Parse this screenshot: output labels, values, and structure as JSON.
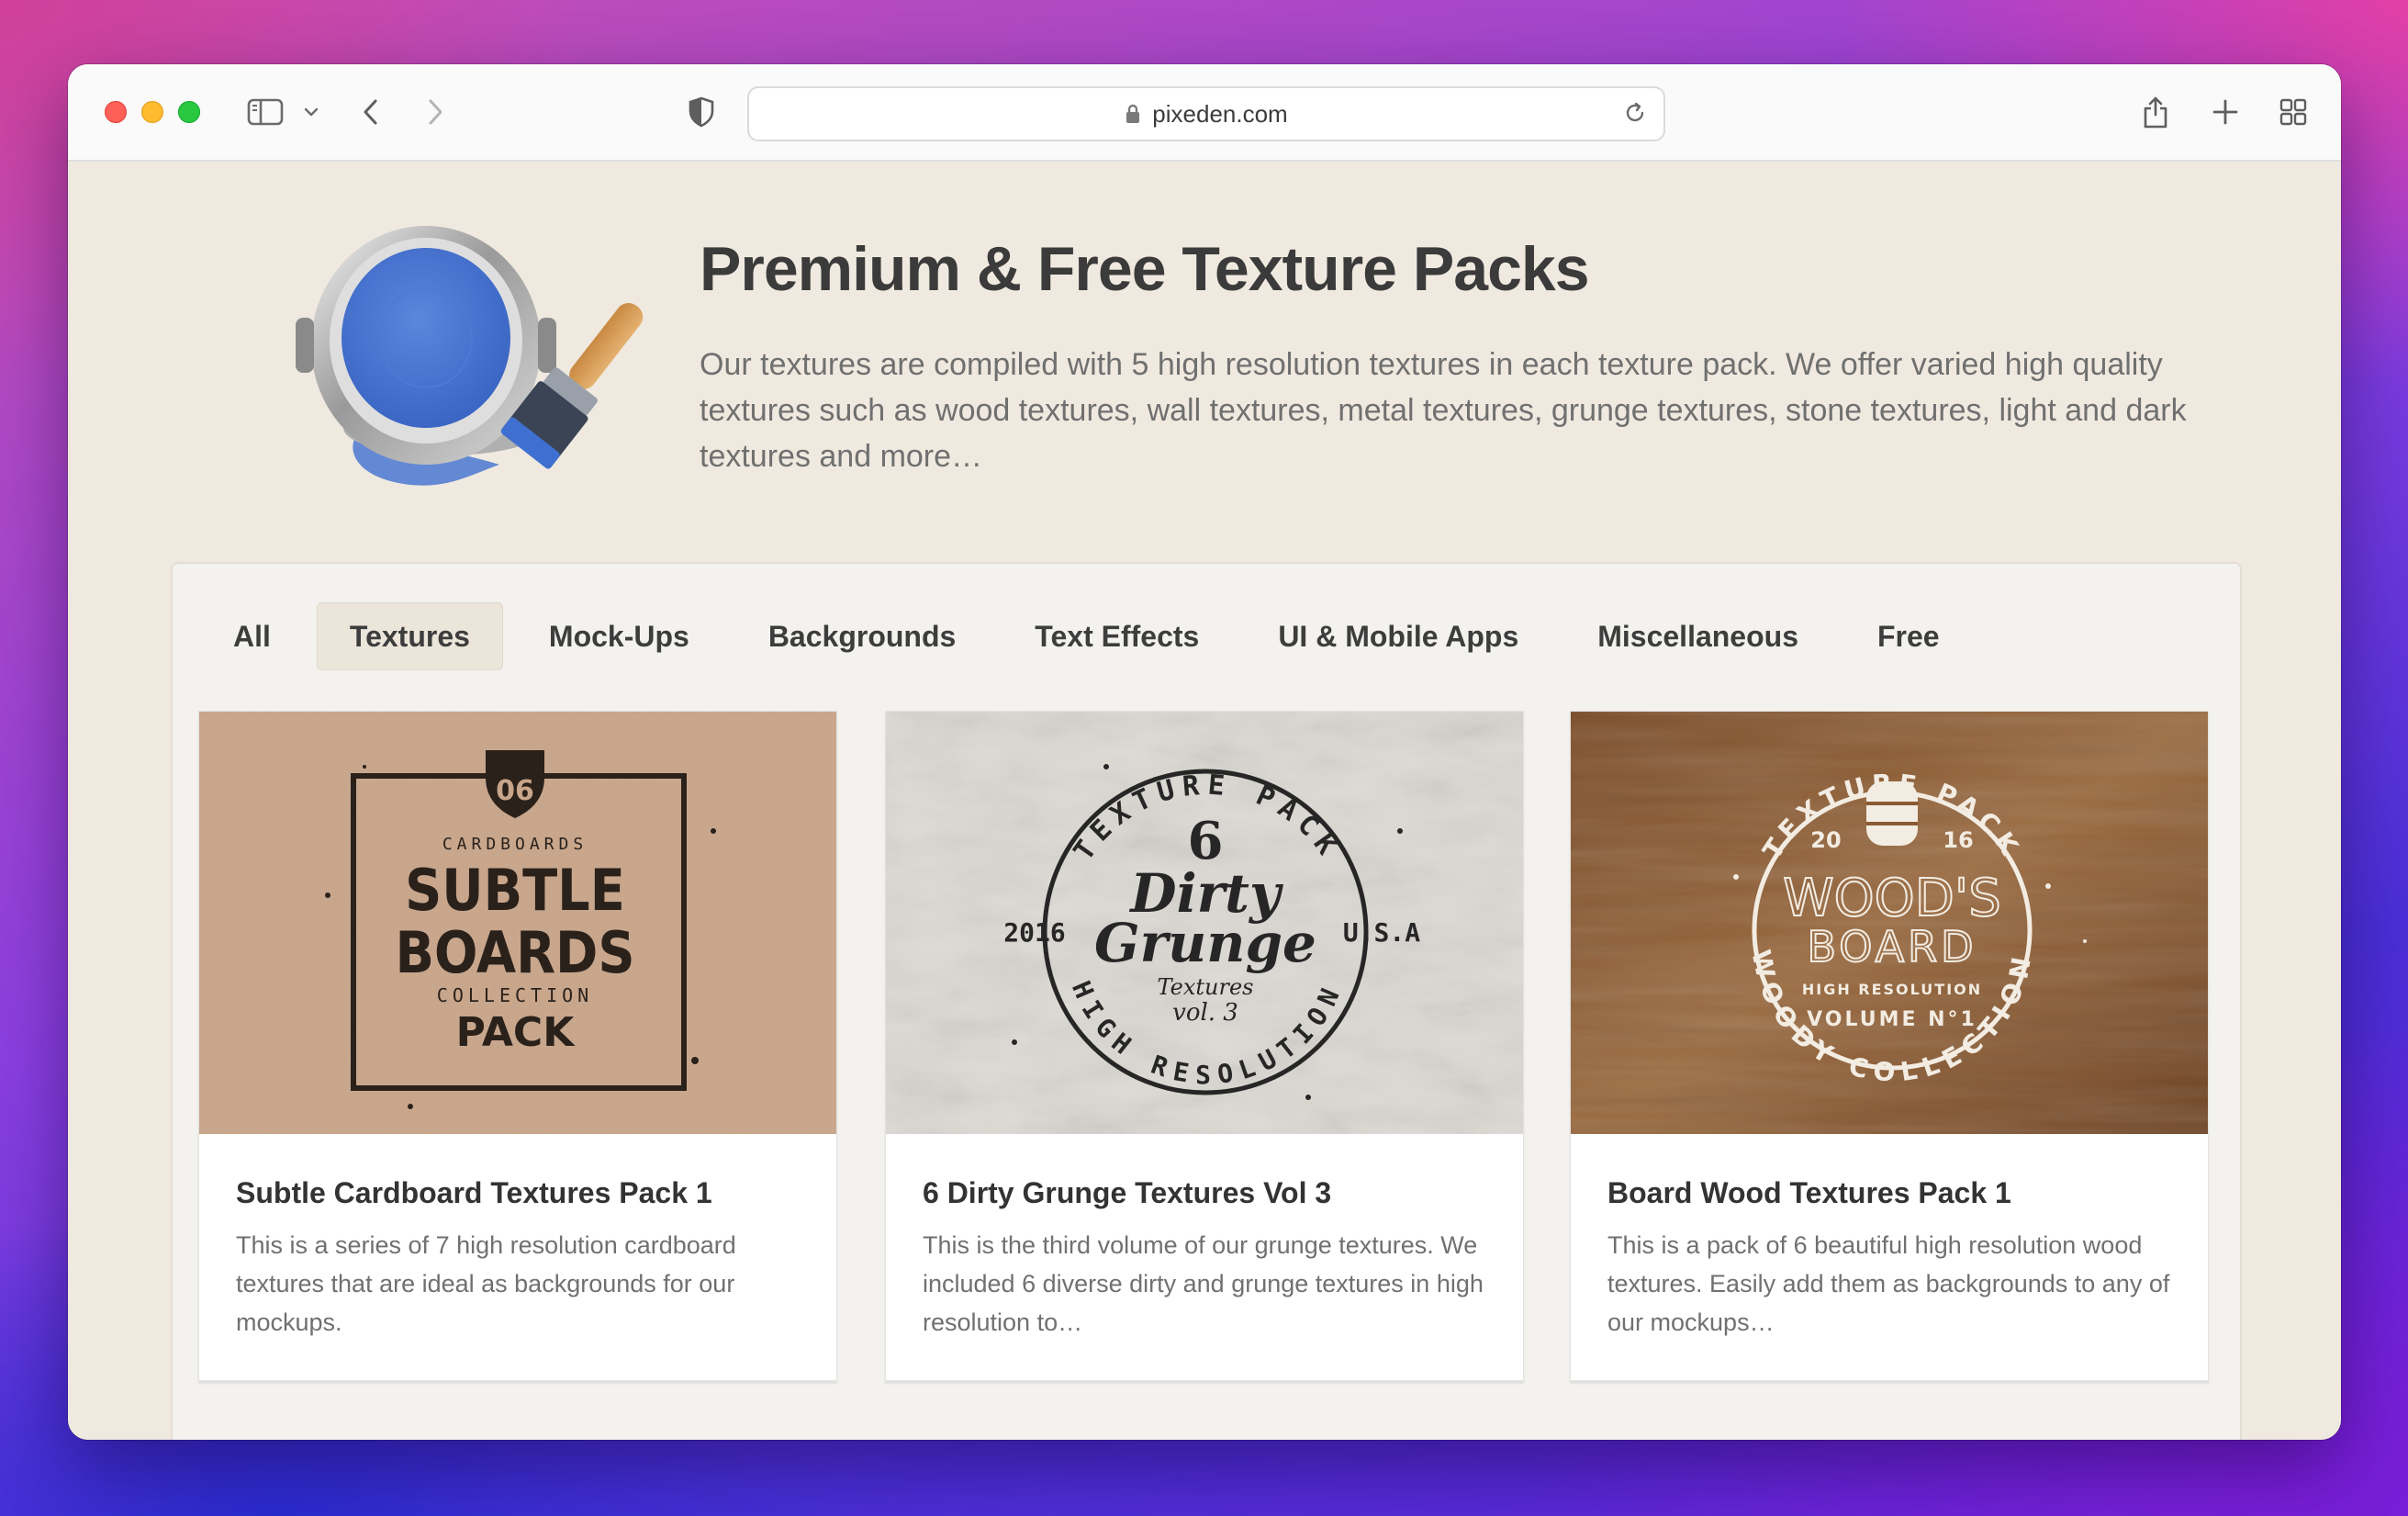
{
  "browser": {
    "url": "pixeden.com",
    "window_controls": [
      "close",
      "minimize",
      "zoom"
    ],
    "toolbar_icons": [
      "sidebar-icon",
      "chevron-down-icon",
      "back-icon",
      "forward-icon",
      "shield-icon",
      "lock-icon",
      "reload-icon",
      "share-icon",
      "new-tab-icon",
      "tab-overview-icon"
    ]
  },
  "hero": {
    "title": "Premium & Free Texture Packs",
    "description": "Our textures are compiled with 5 high resolution textures in each texture pack. We offer varied high quality textures such as wood textures, wall textures, metal textures, grunge textures, stone textures, light and dark textures and more…",
    "icon": "paint-can-brush-icon"
  },
  "tabs": [
    {
      "label": "All",
      "active": false
    },
    {
      "label": "Textures",
      "active": true
    },
    {
      "label": "Mock-Ups",
      "active": false
    },
    {
      "label": "Backgrounds",
      "active": false
    },
    {
      "label": "Text Effects",
      "active": false
    },
    {
      "label": "UI & Mobile Apps",
      "active": false
    },
    {
      "label": "Miscellaneous",
      "active": false
    },
    {
      "label": "Free",
      "active": false
    }
  ],
  "cards": [
    {
      "title": "Subtle Cardboard Textures Pack 1",
      "description": "This is a series of 7 high resolution cardboard textures that are ideal as backgrounds for our mockups.",
      "thumb": {
        "badge": "06",
        "line1": "CARDBOARDS",
        "line2": "SUBTLE",
        "line3": "BOARDS",
        "line4": "COLLECTION",
        "line5": "PACK",
        "bg": "#c9a589"
      }
    },
    {
      "title": "6 Dirty Grunge Textures Vol 3",
      "description": "This is the third volume of our grunge textures. We included 6 diverse dirty and grunge textures in high resolution to…",
      "thumb": {
        "arc_top": "TEXTURE PACK",
        "number": "6",
        "script1": "Dirty",
        "script2": "Grunge",
        "script3": "Textures",
        "vol": "vol. 3",
        "left": "2016",
        "right": "U.S.A",
        "arc_bottom": "HIGH RESOLUTION",
        "bg": "#dcd9d3"
      }
    },
    {
      "title": "Board Wood Textures Pack 1",
      "description": "This is a pack of 6 beautiful high resolution wood textures. Easily add them as backgrounds to any of our mockups…",
      "thumb": {
        "arc_top": "TEXTURE PACK",
        "year_left": "20",
        "year_right": "16",
        "line1": "WOOD'S",
        "line2": "BOARD",
        "line3": "HIGH RESOLUTION",
        "line4": "VOLUME N°1",
        "arc_bottom": "WOODY COLLECTION",
        "bg": "#8a5a32"
      }
    }
  ]
}
